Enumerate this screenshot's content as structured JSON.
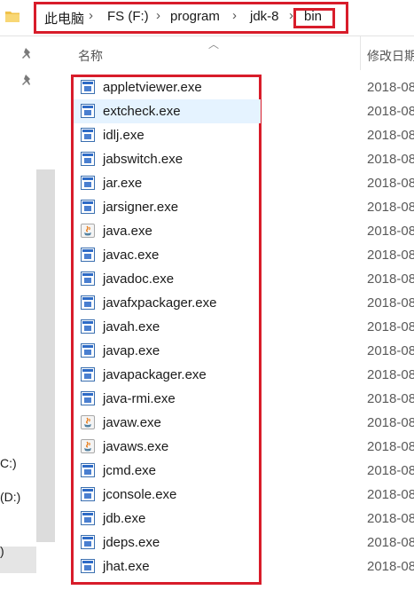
{
  "breadcrumb": {
    "items": [
      "此电脑",
      "FS (F:)",
      "program",
      "jdk-8",
      "bin"
    ],
    "separator": "›"
  },
  "nav": {
    "drives": [
      "C:)",
      "(D:)",
      ")"
    ]
  },
  "columns": {
    "name": "名称",
    "date": "修改日期"
  },
  "files": [
    {
      "name": "appletviewer.exe",
      "date": "2018-08",
      "icon": "exe-icon"
    },
    {
      "name": "extcheck.exe",
      "date": "2018-08",
      "icon": "exe-icon",
      "selected": true
    },
    {
      "name": "idlj.exe",
      "date": "2018-08",
      "icon": "exe-icon"
    },
    {
      "name": "jabswitch.exe",
      "date": "2018-08",
      "icon": "exe-icon"
    },
    {
      "name": "jar.exe",
      "date": "2018-08",
      "icon": "exe-icon"
    },
    {
      "name": "jarsigner.exe",
      "date": "2018-08",
      "icon": "exe-icon"
    },
    {
      "name": "java.exe",
      "date": "2018-08",
      "icon": "java-icon"
    },
    {
      "name": "javac.exe",
      "date": "2018-08",
      "icon": "exe-icon"
    },
    {
      "name": "javadoc.exe",
      "date": "2018-08",
      "icon": "exe-icon"
    },
    {
      "name": "javafxpackager.exe",
      "date": "2018-08",
      "icon": "exe-icon"
    },
    {
      "name": "javah.exe",
      "date": "2018-08",
      "icon": "exe-icon"
    },
    {
      "name": "javap.exe",
      "date": "2018-08",
      "icon": "exe-icon"
    },
    {
      "name": "javapackager.exe",
      "date": "2018-08",
      "icon": "exe-icon"
    },
    {
      "name": "java-rmi.exe",
      "date": "2018-08",
      "icon": "exe-icon"
    },
    {
      "name": "javaw.exe",
      "date": "2018-08",
      "icon": "java-icon"
    },
    {
      "name": "javaws.exe",
      "date": "2018-08",
      "icon": "java-icon"
    },
    {
      "name": "jcmd.exe",
      "date": "2018-08",
      "icon": "exe-icon"
    },
    {
      "name": "jconsole.exe",
      "date": "2018-08",
      "icon": "exe-icon"
    },
    {
      "name": "jdb.exe",
      "date": "2018-08",
      "icon": "exe-icon"
    },
    {
      "name": "jdeps.exe",
      "date": "2018-08",
      "icon": "exe-icon"
    },
    {
      "name": "jhat.exe",
      "date": "2018-08",
      "icon": "exe-icon"
    }
  ],
  "colors": {
    "highlight_border": "#d81c2a",
    "selection": "#e5f3ff"
  }
}
